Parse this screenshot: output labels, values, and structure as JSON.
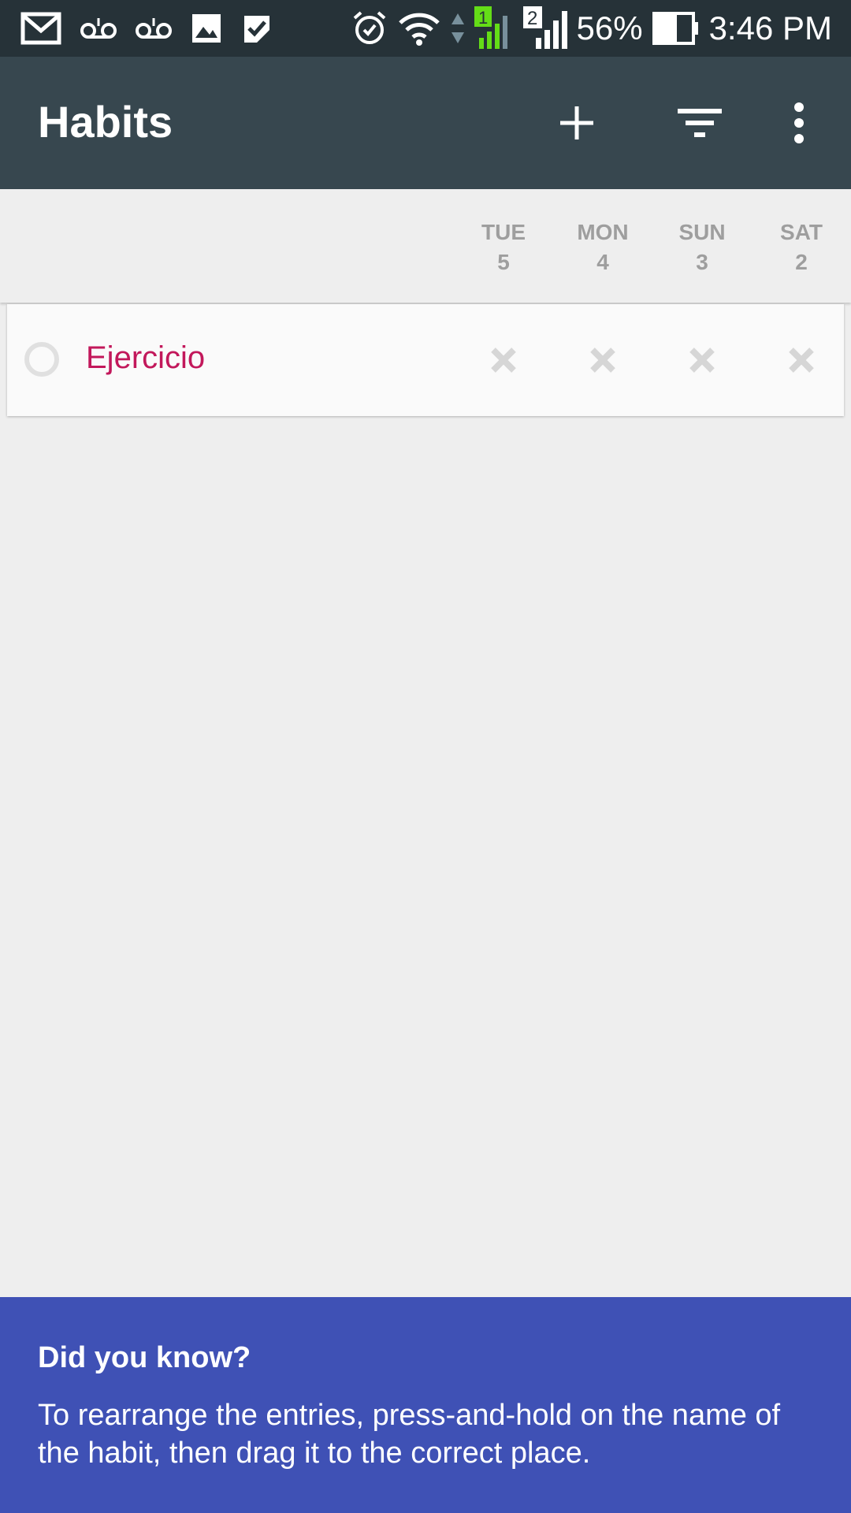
{
  "status_bar": {
    "left_icons": [
      "gmail-icon",
      "voicemail-icon",
      "voicemail-icon",
      "image-icon",
      "tasks-icon"
    ],
    "right_icons": [
      "alarm-icon",
      "wifi-icon",
      "data-arrows-icon",
      "signal-sim1-icon",
      "signal-sim2-icon",
      "battery-icon"
    ],
    "sim1_label": "1",
    "sim2_label": "2",
    "battery": "56%",
    "time": "3:46 PM"
  },
  "toolbar": {
    "title": "Habits",
    "actions": [
      "add-icon",
      "filter-icon",
      "more-icon"
    ]
  },
  "header": {
    "days": [
      {
        "day": "TUE",
        "date": "5"
      },
      {
        "day": "MON",
        "date": "4"
      },
      {
        "day": "SUN",
        "date": "3"
      },
      {
        "day": "SAT",
        "date": "2"
      }
    ]
  },
  "habits": [
    {
      "name": "Ejercicio",
      "color": "#c2185b",
      "checks": [
        "x",
        "x",
        "x",
        "x"
      ]
    }
  ],
  "tip": {
    "title": "Did you know?",
    "body": "To rearrange the entries, press-and-hold on the name of the habit, then drag it to the correct place."
  },
  "colors": {
    "status_bar": "#263238",
    "toolbar": "#37474f",
    "background": "#eeeeee",
    "tip_panel": "#3f51b5",
    "habit": "#c2185b"
  }
}
